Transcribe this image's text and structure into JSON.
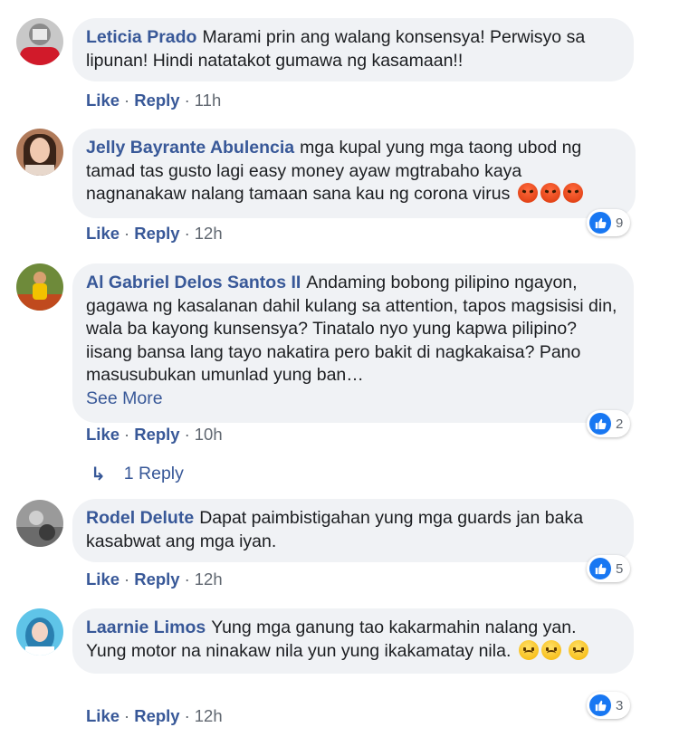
{
  "comments": [
    {
      "author": "Leticia Prado",
      "text": "Marami prin ang walang konsensya! Perwisyo sa lipunan! Hindi natatakot gumawa ng kasamaan!!",
      "like_label": "Like",
      "reply_label": "Reply",
      "time": "11h"
    },
    {
      "author": "Jelly Bayrante Abulencia",
      "text": "mga kupal yung mga taong ubod ng tamad tas gusto lagi easy money ayaw mgtrabaho kaya nagnanakaw nalang tamaan sana kau ng corona virus",
      "like_label": "Like",
      "reply_label": "Reply",
      "time": "12h",
      "reaction_count": "9"
    },
    {
      "author": "Al Gabriel Delos Santos II",
      "text": "Andaming bobong pilipino ngayon, gagawa ng kasalanan dahil kulang sa attention, tapos magsisisi din, wala ba kayong kunsensya? Tinatalo nyo yung kapwa pilipino? iisang bansa lang tayo nakatira pero bakit di nagkakaisa? Pano masusubukan umunlad yung ban…",
      "see_more": "See More",
      "like_label": "Like",
      "reply_label": "Reply",
      "time": "10h",
      "reaction_count": "2",
      "replies_label": "1 Reply"
    },
    {
      "author": "Rodel Delute",
      "text": "Dapat paimbistigahan yung mga guards jan baka kasabwat ang mga iyan.",
      "like_label": "Like",
      "reply_label": "Reply",
      "time": "12h",
      "reaction_count": "5"
    },
    {
      "author": "Laarnie Limos",
      "text": "Yung mga ganung tao kakarmahin nalang yan. Yung motor na ninakaw nila yun yung ikakamatay nila.",
      "like_label": "Like",
      "reply_label": "Reply",
      "time": "12h",
      "reaction_count": "3"
    }
  ],
  "colors": {
    "author_link": "#385898",
    "bubble_bg": "#f0f2f5",
    "like_blue": "#1877f2",
    "meta_gray": "#606770"
  }
}
